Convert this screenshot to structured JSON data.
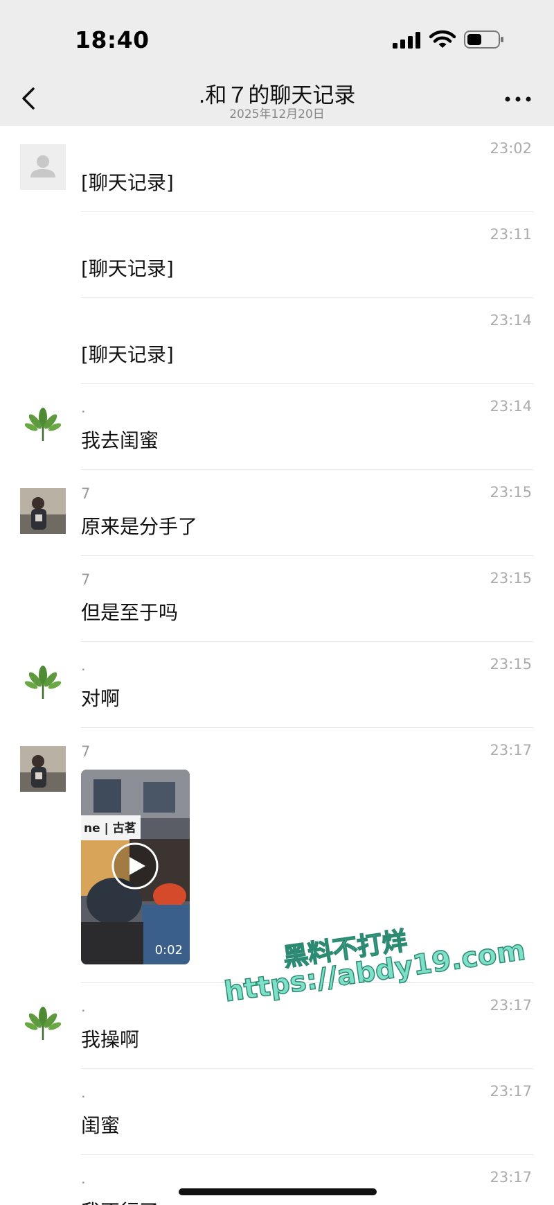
{
  "status_bar": {
    "time": "18:40"
  },
  "header": {
    "title": ".和７的聊天记录",
    "date": "2025年12月20日"
  },
  "messages": [
    {
      "sender": "",
      "time": "23:02",
      "text": "[聊天记录]"
    },
    {
      "sender": "",
      "time": "23:11",
      "text": "[聊天记录]"
    },
    {
      "sender": "",
      "time": "23:14",
      "text": "[聊天记录]"
    },
    {
      "sender": ".",
      "time": "23:14",
      "text": "我去闺蜜"
    },
    {
      "sender": "7",
      "time": "23:15",
      "text": "原来是分手了"
    },
    {
      "sender": "7",
      "time": "23:15",
      "text": "但是至于吗"
    },
    {
      "sender": ".",
      "time": "23:15",
      "text": "对啊"
    },
    {
      "sender": "7",
      "time": "23:17",
      "video_duration": "0:02",
      "video_sign": "ne | 古茗"
    },
    {
      "sender": ".",
      "time": "23:17",
      "text": "我操啊"
    },
    {
      "sender": ".",
      "time": "23:17",
      "text": "闺蜜"
    },
    {
      "sender": ".",
      "time": "23:17",
      "text": "我不行了"
    }
  ],
  "watermark": {
    "line1": "黑料不打烊",
    "line2": "https://abdy19.com"
  }
}
